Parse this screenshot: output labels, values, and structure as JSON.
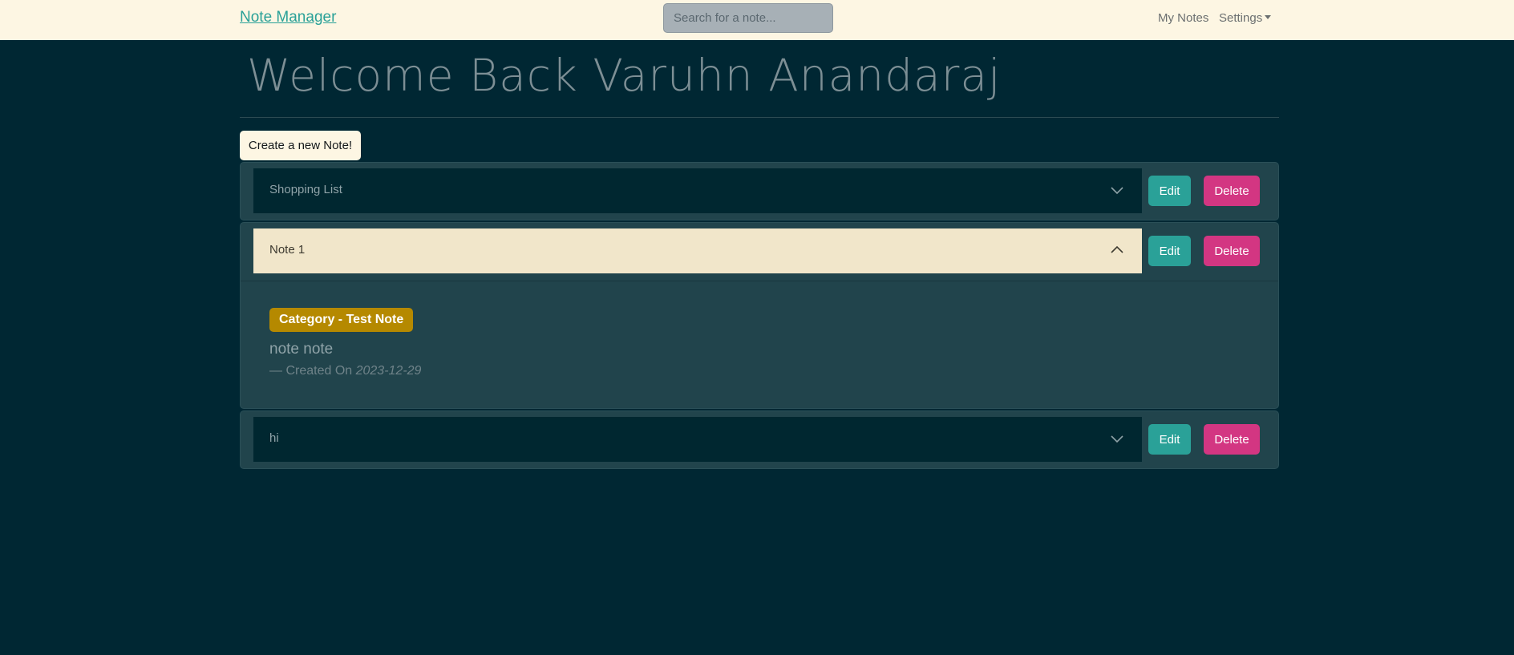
{
  "navbar": {
    "brand": "Note Manager",
    "search_placeholder": "Search for a note...",
    "links": {
      "my_notes": "My Notes",
      "settings": "Settings"
    }
  },
  "page": {
    "welcome": "Welcome Back Varuhn Anandaraj",
    "create_button": "Create a new Note!"
  },
  "notes": [
    {
      "title": "Shopping List",
      "expanded": false,
      "edit_label": "Edit",
      "delete_label": "Delete"
    },
    {
      "title": "Note 1",
      "expanded": true,
      "category_badge": "Category - Test Note",
      "content": "note note",
      "created_prefix": "— Created On",
      "created_date": "2023-12-29",
      "edit_label": "Edit",
      "delete_label": "Delete"
    },
    {
      "title": "hi",
      "expanded": false,
      "edit_label": "Edit",
      "delete_label": "Delete"
    }
  ],
  "colors": {
    "background": "#002733",
    "navbar": "#fdf6e3",
    "accent": "#2aa198",
    "danger": "#d33682",
    "badge": "#b58900"
  },
  "icons": {
    "collapsed": "chevron-down-icon",
    "expanded": "chevron-up-icon"
  }
}
